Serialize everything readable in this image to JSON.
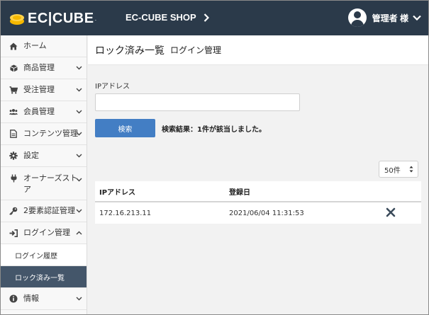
{
  "header": {
    "logo_text": "EC|CUBE",
    "logo_mark_text": ".",
    "shop_name": "EC-CUBE SHOP",
    "user_name": "管理者 様"
  },
  "sidebar": {
    "items": [
      {
        "label": "ホーム",
        "icon": "home-icon"
      },
      {
        "label": "商品管理",
        "icon": "cube-icon"
      },
      {
        "label": "受注管理",
        "icon": "cart-icon"
      },
      {
        "label": "会員管理",
        "icon": "users-icon"
      },
      {
        "label": "コンテンツ管理",
        "icon": "file-icon"
      },
      {
        "label": "設定",
        "icon": "gear-icon"
      },
      {
        "label": "オーナーズストア",
        "icon": "plug-icon"
      },
      {
        "label": "2要素認証管理",
        "icon": "key-icon"
      },
      {
        "label": "ログイン管理",
        "icon": "sign-in-icon"
      }
    ],
    "sub_items": [
      {
        "label": "ログイン履歴"
      },
      {
        "label": "ロック済み一覧"
      }
    ],
    "last_item": {
      "label": "情報",
      "icon": "info-icon"
    }
  },
  "page": {
    "title": "ロック済み一覧",
    "subtitle": "ログイン管理"
  },
  "search": {
    "ip_label": "IPアドレス",
    "ip_value": "",
    "button_label": "検索",
    "result_text": "検索結果：1件が該当しました。"
  },
  "pagination": {
    "per_page": "50件"
  },
  "table": {
    "headers": [
      "IPアドレス",
      "登録日"
    ],
    "rows": [
      {
        "ip": "172.16.213.11",
        "date": "2021/06/04 11:31:53"
      }
    ]
  },
  "colors": {
    "header_bg": "#2b3a4a",
    "active_bg": "#44566a",
    "primary": "#437ec4",
    "logo_accent": "#f5b800"
  }
}
